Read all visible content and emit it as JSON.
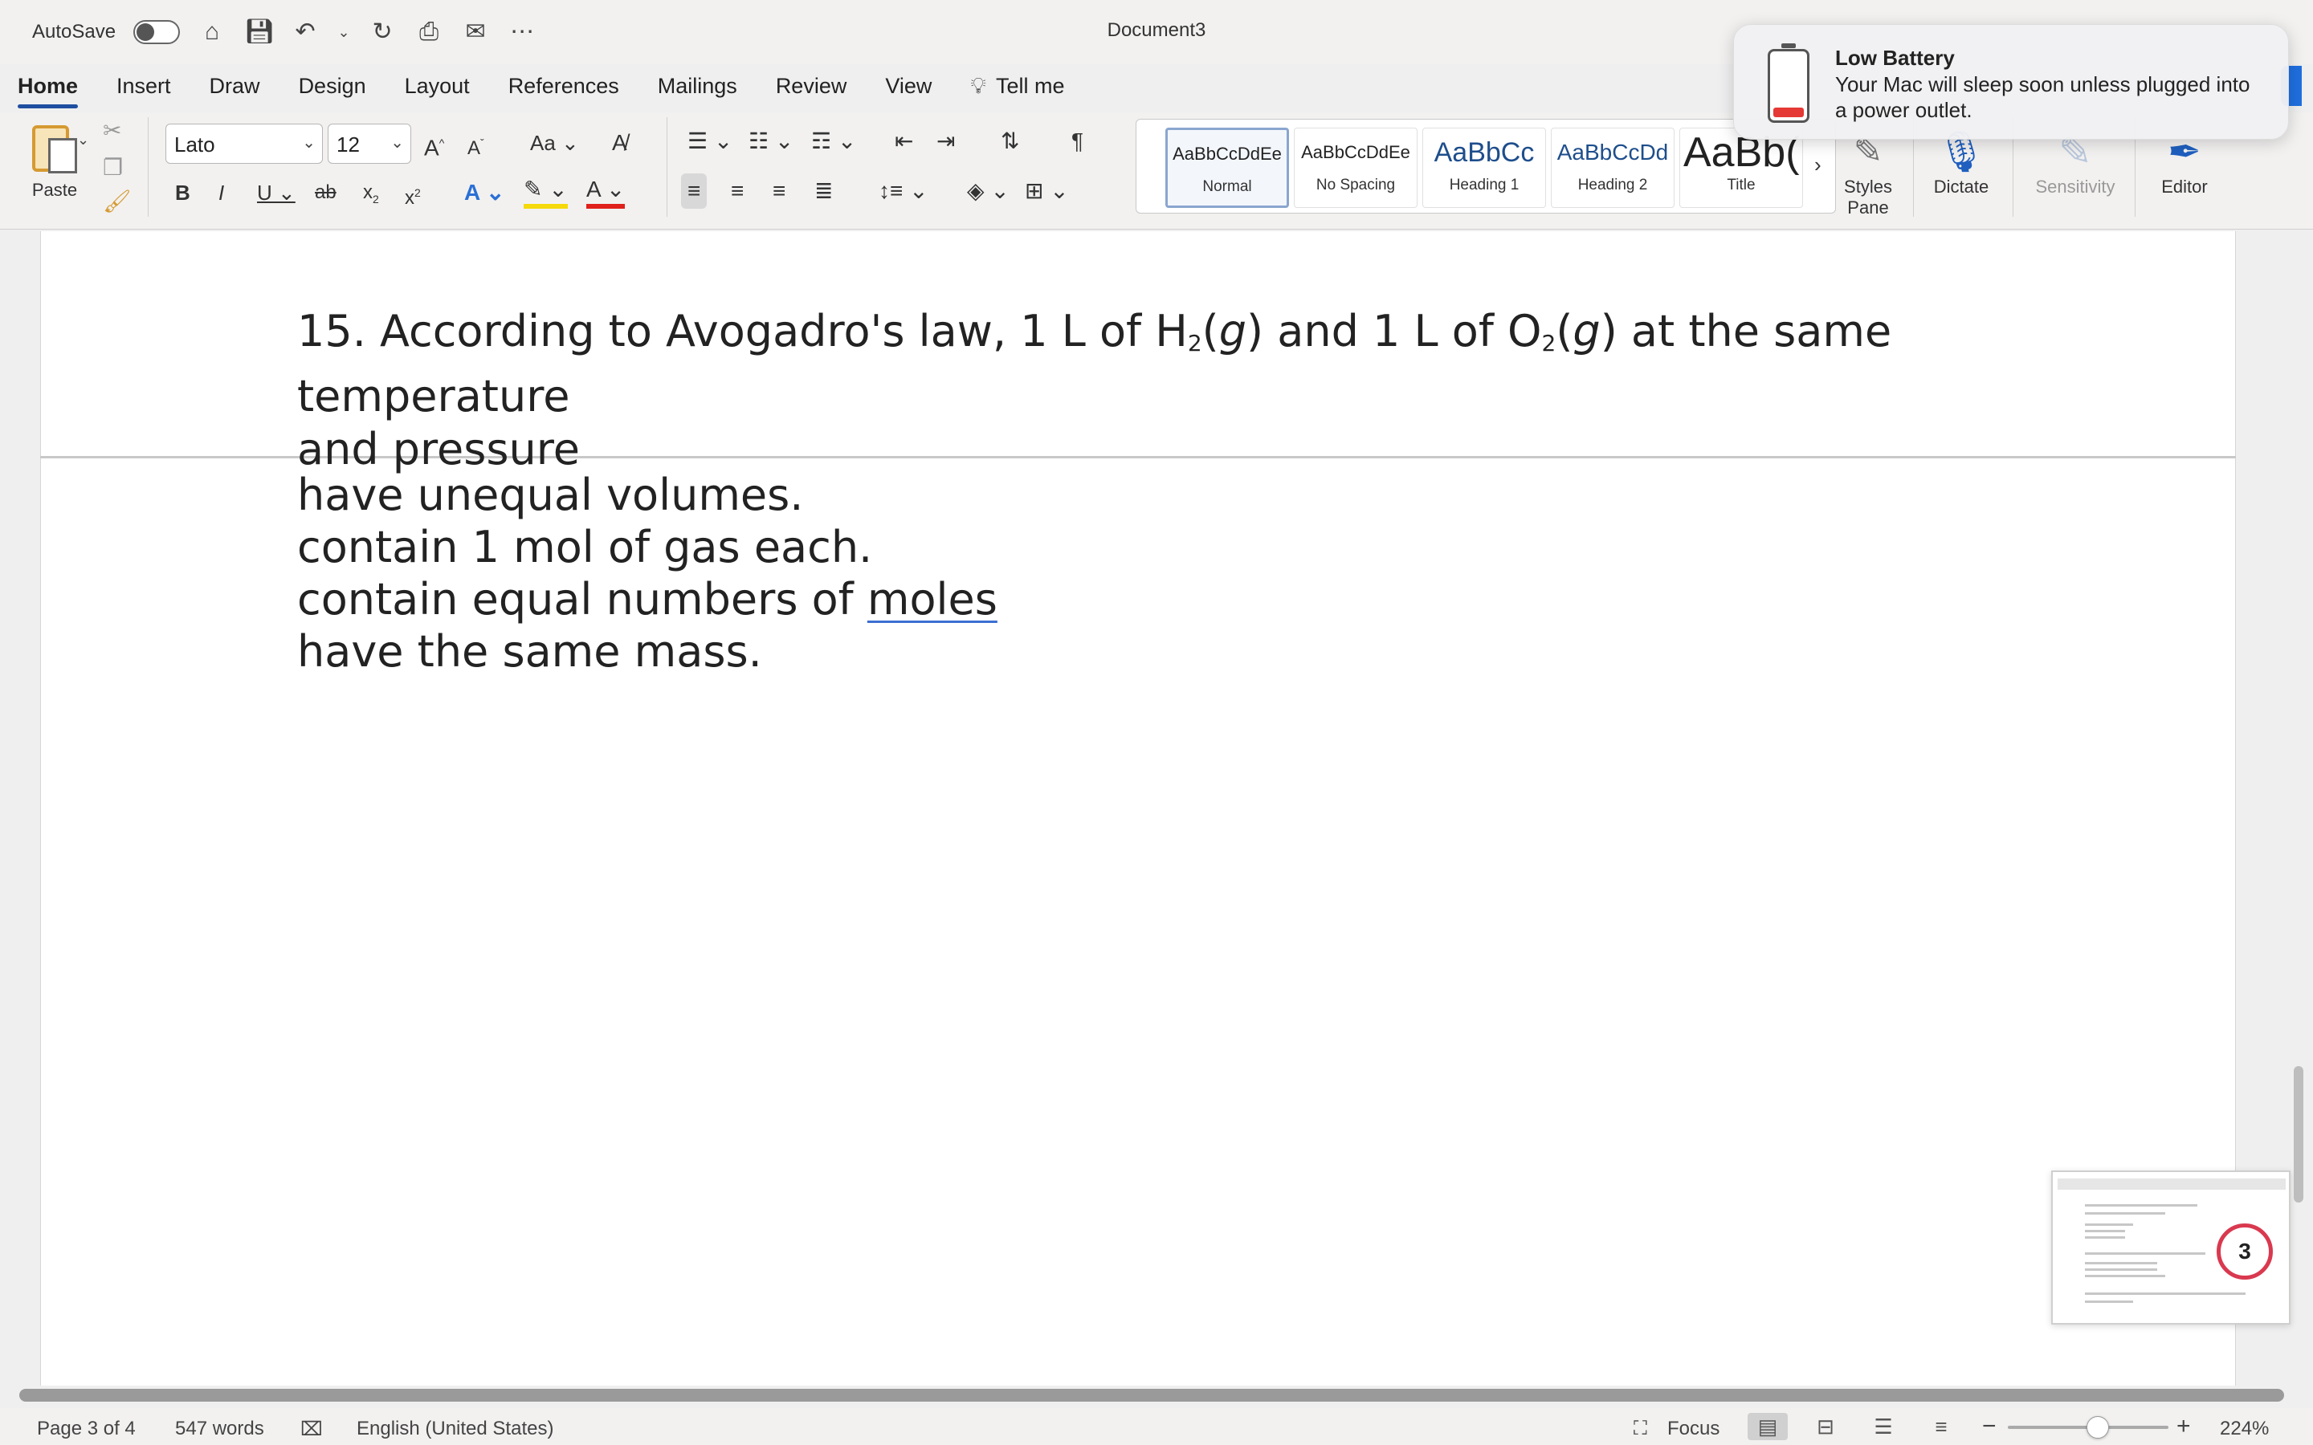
{
  "titlebar": {
    "autosave_label": "AutoSave",
    "document_title": "Document3",
    "icons": [
      "home-icon",
      "save-icon",
      "undo-icon",
      "redo-icon",
      "print-icon",
      "mail-icon",
      "more-icon"
    ]
  },
  "tabs": [
    {
      "label": "Home",
      "active": true
    },
    {
      "label": "Insert"
    },
    {
      "label": "Draw"
    },
    {
      "label": "Design"
    },
    {
      "label": "Layout"
    },
    {
      "label": "References"
    },
    {
      "label": "Mailings"
    },
    {
      "label": "Review"
    },
    {
      "label": "View"
    }
  ],
  "tell_me": "Tell me",
  "ribbon": {
    "paste_label": "Paste",
    "font_name": "Lato",
    "font_size": "12",
    "change_case": "Aa",
    "styles": [
      {
        "preview": "AaBbCcDdEe",
        "name": "Normal",
        "selected": true
      },
      {
        "preview": "AaBbCcDdEe",
        "name": "No Spacing"
      },
      {
        "preview": "AaBbCc",
        "name": "Heading 1"
      },
      {
        "preview": "AaBbCcDd",
        "name": "Heading 2"
      },
      {
        "preview": "AaBb(",
        "name": "Title"
      }
    ],
    "styles_pane_label_1": "Styles",
    "styles_pane_label_2": "Pane",
    "dictate_label": "Dictate",
    "sensitivity_label": "Sensitivity",
    "editor_label": "Editor"
  },
  "document": {
    "question_prefix": "15. According to Avogadro's law, 1 L of H",
    "sub1": "2",
    "mid1": "(",
    "g1": "g",
    "mid2": ") and 1 L of O",
    "sub2": "2",
    "mid3": "(",
    "g2": "g",
    "question_suffix": ") at the same temperature",
    "question_line2": "and pressure",
    "answers": [
      "have unequal volumes.",
      "contain 1 mol of gas each.",
      "contain equal numbers of ",
      "have the same mass."
    ],
    "answer3_underlined": "moles"
  },
  "notification": {
    "title": "Low Battery",
    "body": "Your Mac will sleep soon unless plugged into a power outlet."
  },
  "thumbnail": {
    "badge": "3"
  },
  "statusbar": {
    "page": "Page 3 of 4",
    "words": "547 words",
    "language": "English (United States)",
    "focus": "Focus",
    "zoom": "224%",
    "zoom_level": 0.56
  },
  "colors": {
    "accent": "#1f4fa0",
    "battery_low": "#e53935",
    "highlight": "#f5d90a",
    "font_color": "#e0201b"
  }
}
